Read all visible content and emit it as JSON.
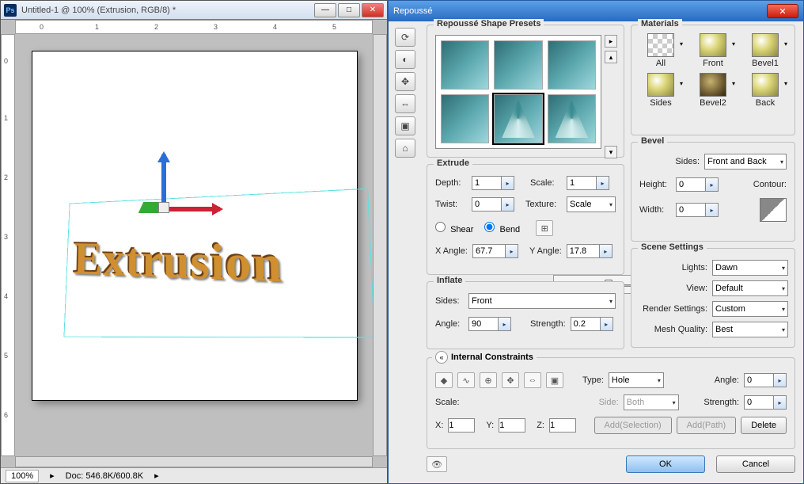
{
  "ps": {
    "title": "Untitled-1 @ 100% (Extrusion, RGB/8) *",
    "zoom": "100%",
    "docinfo": "Doc: 546.8K/600.8K",
    "canvas_text": "Extrusion",
    "ruler_v": [
      "0",
      "1",
      "2",
      "3",
      "4",
      "5",
      "6"
    ],
    "ruler_h": [
      "0",
      "1",
      "2",
      "3",
      "4",
      "5"
    ]
  },
  "dlg": {
    "title": "Repoussé",
    "presets_label": "Repoussé Shape Presets",
    "materials": {
      "label": "Materials",
      "items": [
        "All",
        "Front",
        "Bevel1",
        "Sides",
        "Bevel2",
        "Back"
      ]
    },
    "extrude": {
      "label": "Extrude",
      "depth_label": "Depth:",
      "depth": "1",
      "scale_label": "Scale:",
      "scale": "1",
      "twist_label": "Twist:",
      "twist": "0",
      "texture_label": "Texture:",
      "texture": "Scale",
      "shear": "Shear",
      "bend": "Bend",
      "xang_label": "X Angle:",
      "xang": "67.7",
      "yang_label": "Y Angle:",
      "yang": "17.8"
    },
    "bevel": {
      "label": "Bevel",
      "sides_label": "Sides:",
      "sides": "Front and Back",
      "height_label": "Height:",
      "height": "0",
      "width_label": "Width:",
      "width": "0",
      "contour_label": "Contour:"
    },
    "inflate": {
      "label": "Inflate",
      "sides_label": "Sides:",
      "sides": "Front",
      "angle_label": "Angle:",
      "angle": "90",
      "strength_label": "Strength:",
      "strength": "0.2"
    },
    "scene": {
      "label": "Scene Settings",
      "lights_label": "Lights:",
      "lights": "Dawn",
      "view_label": "View:",
      "view": "Default",
      "render_label": "Render Settings:",
      "render": "Custom",
      "mesh_label": "Mesh Quality:",
      "mesh": "Best"
    },
    "internal": {
      "label": "Internal Constraints",
      "type_label": "Type:",
      "type": "Hole",
      "side_label": "Side:",
      "side": "Both",
      "angle_label": "Angle:",
      "angle": "0",
      "strength_label": "Strength:",
      "strength": "0",
      "scale_label": "Scale:",
      "x_label": "X:",
      "x": "1",
      "y_label": "Y:",
      "y": "1",
      "z_label": "Z:",
      "z": "1",
      "addsel": "Add(Selection)",
      "addpath": "Add(Path)",
      "delete": "Delete"
    },
    "ok": "OK",
    "cancel": "Cancel"
  }
}
